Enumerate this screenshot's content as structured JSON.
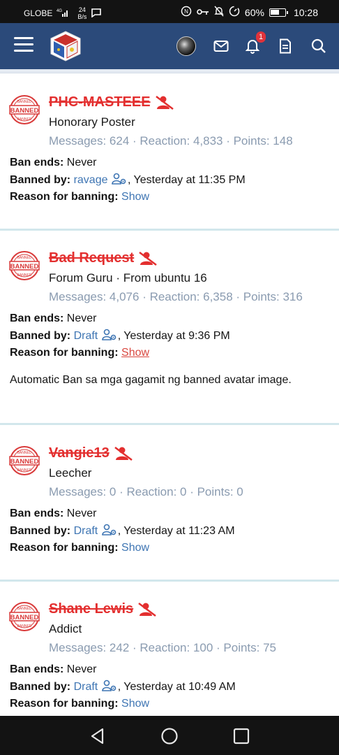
{
  "status_bar": {
    "carrier": "GLOBE",
    "network": "4G",
    "speed": "24",
    "speed_unit": "B/s",
    "battery": "60%",
    "time": "10:28"
  },
  "header": {
    "notification_count": "1"
  },
  "labels": {
    "ban_ends": "Ban ends:",
    "banned_by": "Banned by:",
    "reason": "Reason for banning:"
  },
  "members": [
    {
      "username": "PHC-MASTEEE",
      "title": "Honorary Poster",
      "stats": "Messages: 624 · Reaction: 4,833 · Points: 148",
      "ban_ends": "Never",
      "banned_by": "ravage",
      "banned_at": ", Yesterday at 11:35 PM",
      "reason_link": "Show"
    },
    {
      "username": "Bad Request",
      "title": "Forum Guru · From ubuntu 16",
      "stats": "Messages: 4,076 · Reaction: 6,358 · Points: 316",
      "ban_ends": "Never",
      "banned_by": "Draft",
      "banned_at": ", Yesterday at 9:36 PM",
      "reason_link": "Show",
      "note": "Automatic Ban sa mga gagamit ng banned avatar image."
    },
    {
      "username": "Vangie13",
      "title": "Leecher",
      "stats": "Messages: 0 · Reaction: 0 · Points: 0",
      "ban_ends": "Never",
      "banned_by": "Draft",
      "banned_at": ", Yesterday at 11:23 AM",
      "reason_link": "Show"
    },
    {
      "username": "Shane Lewis",
      "title": "Addict",
      "stats": "Messages: 242 · Reaction: 100 · Points: 75",
      "ban_ends": "Never",
      "banned_by": "Draft",
      "banned_at": ", Yesterday at 10:49 AM",
      "reason_link": "Show"
    }
  ],
  "colors": {
    "header_bg": "#2b4a7a",
    "banned_red": "#e32f2f",
    "link_blue": "#3e75b3",
    "stats_gray": "#8a9bb0"
  }
}
